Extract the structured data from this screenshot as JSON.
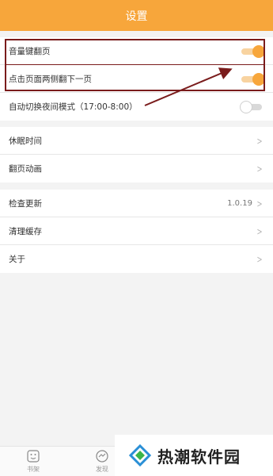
{
  "header": {
    "title": "设置"
  },
  "group1": {
    "items": [
      {
        "label": "音量键翻页",
        "toggle": true
      },
      {
        "label": "点击页面两侧翻下一页",
        "toggle": true
      },
      {
        "label": "自动切换夜间模式（17:00-8:00）",
        "toggle": false
      }
    ]
  },
  "group2": {
    "items": [
      {
        "label": "休眠时间"
      },
      {
        "label": "翻页动画"
      }
    ]
  },
  "group3": {
    "items": [
      {
        "label": "检查更新",
        "value": "1.0.19"
      },
      {
        "label": "清理缓存"
      },
      {
        "label": "关于"
      }
    ]
  },
  "bottom_tabs": [
    {
      "label": "书架",
      "icon": "bookshelf-icon"
    },
    {
      "label": "发现",
      "icon": "discover-icon"
    }
  ],
  "watermark": {
    "text": "热潮软件园",
    "icon": "diamond-logo-icon"
  },
  "colors": {
    "accent": "#f7a63b",
    "annotation": "#7a1c1c",
    "background": "#f3f3f3"
  }
}
